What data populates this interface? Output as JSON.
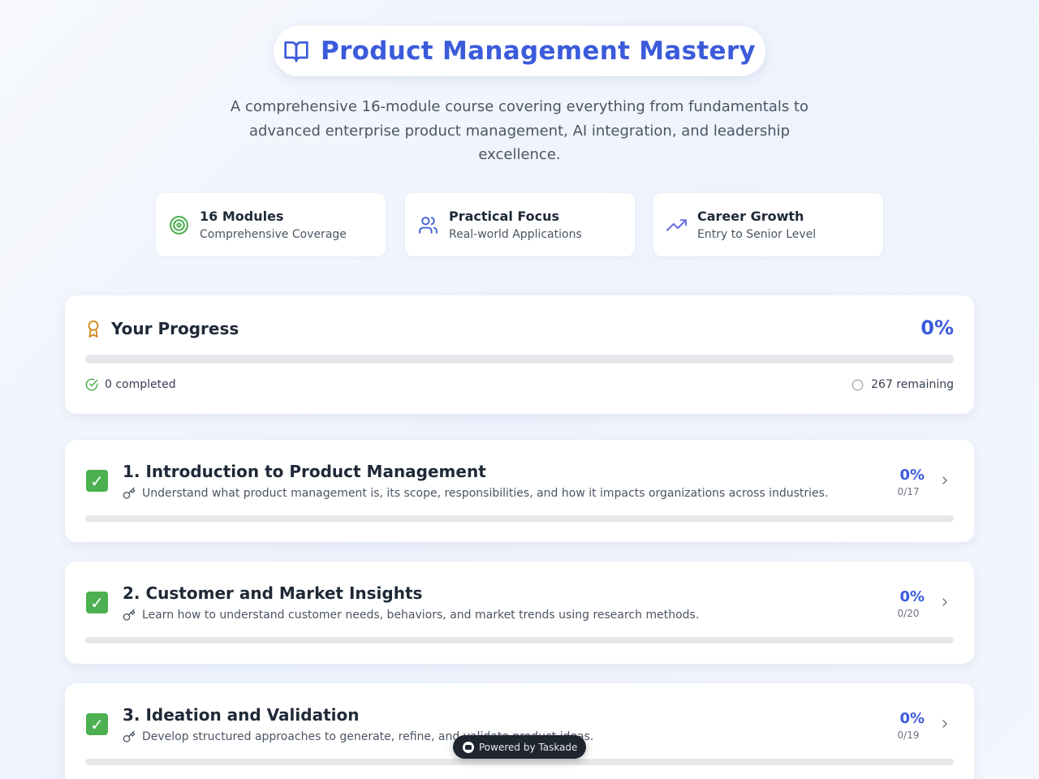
{
  "header": {
    "title": "Product Management Mastery",
    "title_icon": "book-open-icon",
    "subtitle": "A comprehensive 16-module course covering everything from fundamentals to advanced enterprise product management, AI integration, and leadership excellence."
  },
  "stats": [
    {
      "icon": "target-icon",
      "title": "16 Modules",
      "subtitle": "Comprehensive Coverage"
    },
    {
      "icon": "users-icon",
      "title": "Practical Focus",
      "subtitle": "Real-world Applications"
    },
    {
      "icon": "trending-up-icon",
      "title": "Career Growth",
      "subtitle": "Entry to Senior Level"
    }
  ],
  "progress": {
    "title": "Your Progress",
    "percent_label": "0%",
    "percent": 0,
    "completed_label": "0 completed",
    "remaining_label": "267 remaining"
  },
  "modules": [
    {
      "title": "1. Introduction to Product Management",
      "description": "Understand what product management is, its scope, responsibilities, and how it impacts organizations across industries.",
      "percent_label": "0%",
      "count_label": "0/17",
      "percent": 0
    },
    {
      "title": "2. Customer and Market Insights",
      "description": "Learn how to understand customer needs, behaviors, and market trends using research methods.",
      "percent_label": "0%",
      "count_label": "0/20",
      "percent": 0
    },
    {
      "title": "3. Ideation and Validation",
      "description": "Develop structured approaches to generate, refine, and validate product ideas.",
      "percent_label": "0%",
      "count_label": "0/19",
      "percent": 0
    }
  ],
  "badge": {
    "label": "Powered by Taskade"
  },
  "colors": {
    "accent": "#3b5bdb",
    "check_green": "#4caf50",
    "award_orange": "#d4891c",
    "stat_green": "#4caf50"
  }
}
